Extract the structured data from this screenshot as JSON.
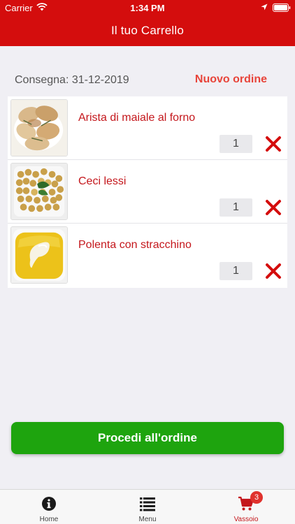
{
  "status_bar": {
    "carrier": "Carrier",
    "time": "1:34 PM"
  },
  "header": {
    "title": "Il tuo Carrello"
  },
  "delivery": {
    "label": "Consegna: 31-12-2019",
    "new_order": "Nuovo ordine"
  },
  "cart": {
    "items": [
      {
        "name": "Arista di maiale al forno",
        "quantity": "1",
        "image_icon": "roast-pork-photo"
      },
      {
        "name": "Ceci lessi",
        "quantity": "1",
        "image_icon": "chickpeas-photo"
      },
      {
        "name": "Polenta con stracchino",
        "quantity": "1",
        "image_icon": "polenta-photo"
      }
    ]
  },
  "actions": {
    "proceed": "Procedi all'ordine"
  },
  "tabbar": {
    "tabs": [
      {
        "label": "Home",
        "icon": "info-icon"
      },
      {
        "label": "Menu",
        "icon": "list-icon"
      },
      {
        "label": "Vassoio",
        "icon": "cart-icon",
        "active": true
      }
    ],
    "cart_badge": "3"
  },
  "colors": {
    "header": "#d40d0d",
    "accent_red": "#c4171c",
    "new_order": "#e8443a",
    "proceed": "#1ea40e",
    "badge": "#e0322d"
  }
}
